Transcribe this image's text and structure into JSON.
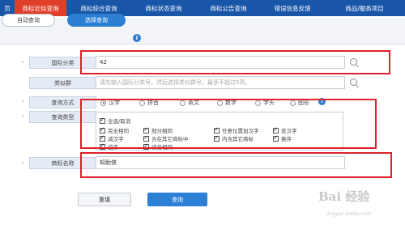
{
  "nav": {
    "tabs": [
      {
        "label": "页"
      },
      {
        "label": "商标近似查询"
      },
      {
        "label": "商标综合查询"
      },
      {
        "label": "商标状态查询"
      },
      {
        "label": "商标公告查询"
      },
      {
        "label": "错误信息反馈"
      },
      {
        "label": "商品/服务项目"
      }
    ],
    "active_tab": "商标近似查询"
  },
  "subbar": {
    "auto_query": "自动查询",
    "select_query": "选择查询",
    "info_icon": "i"
  },
  "form": {
    "intl_class": {
      "label": "国际分类",
      "value": "42"
    },
    "group": {
      "label": "类似群",
      "placeholder": "请先输入国际分类号，然后选择类似群号，最多不超过5项。"
    },
    "query_method": {
      "label": "查询方式",
      "options": [
        "汉字",
        "拼音",
        "英文",
        "数字",
        "字头",
        "图形"
      ],
      "selected": "汉字"
    },
    "query_type": {
      "label": "查询类型",
      "select_all": "全选/取消",
      "options": [
        "完全相同",
        "部分相同",
        "任意位置加汉字",
        "变汉字",
        "减汉字",
        "含在其它商标中",
        "内含其它商标",
        "换序",
        "逆序",
        "读音相同"
      ]
    },
    "trademark_name": {
      "label": "商标名称",
      "value": "知助侠"
    }
  },
  "buttons": {
    "reset": "重填",
    "query": "查询"
  },
  "watermark": {
    "text": "Bai 经验",
    "url": "jingyan.baidu.com"
  },
  "colors": {
    "nav_bg": "#1a56a8",
    "active_tab": "#e0402a",
    "accent": "#2d7fd6",
    "highlight": "#e0202a"
  }
}
